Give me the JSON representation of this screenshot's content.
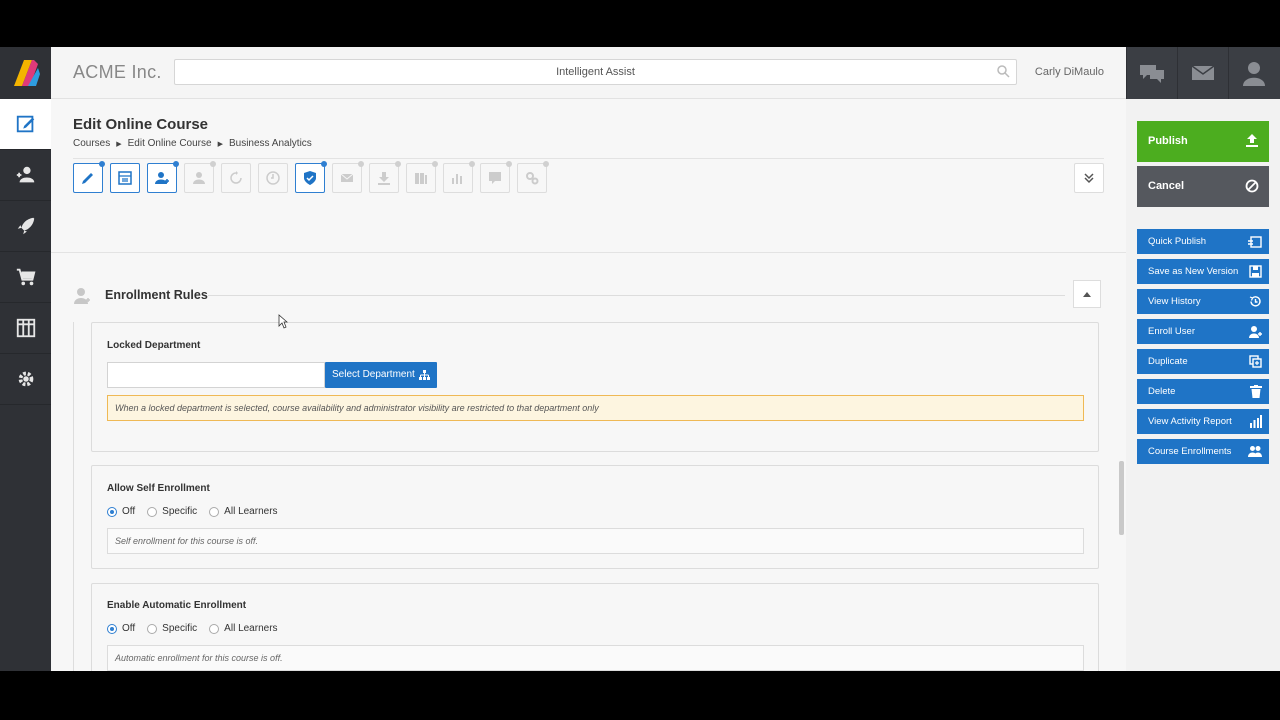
{
  "header": {
    "brand": "ACME Inc.",
    "search_label": "Intelligent Assist",
    "user_name": "Carly DiMaulo"
  },
  "page": {
    "title": "Edit Online Course",
    "breadcrumb": [
      "Courses",
      "Edit Online Course",
      "Business Analytics"
    ]
  },
  "section": {
    "title": "Enrollment Rules"
  },
  "locked_department": {
    "title": "Locked Department",
    "input_value": "",
    "button_label": "Select Department",
    "alert": "When a locked department is selected, course availability and administrator visibility are restricted to that department only"
  },
  "self_enrollment": {
    "title": "Allow Self Enrollment",
    "options": [
      "Off",
      "Specific",
      "All Learners"
    ],
    "selected": "Off",
    "note": "Self enrollment for this course is off."
  },
  "auto_enrollment": {
    "title": "Enable Automatic Enrollment",
    "options": [
      "Off",
      "Specific",
      "All Learners"
    ],
    "selected": "Off",
    "note": "Automatic enrollment for this course is off."
  },
  "actions": {
    "publish": "Publish",
    "cancel": "Cancel",
    "quick_publish": "Quick Publish",
    "save_new_version": "Save as New Version",
    "view_history": "View History",
    "enroll_user": "Enroll User",
    "duplicate": "Duplicate",
    "delete": "Delete",
    "view_activity_report": "View Activity Report",
    "course_enrollments": "Course Enrollments"
  },
  "colors": {
    "primary_blue": "#1f74c6",
    "publish_green": "#4cad1f",
    "cancel_gray": "#55585e",
    "sidebar_dark": "#2f3136",
    "alert_border": "#efb955"
  }
}
